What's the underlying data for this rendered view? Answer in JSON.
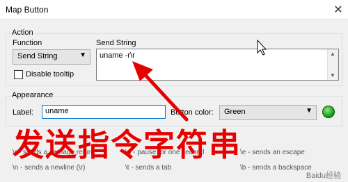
{
  "window": {
    "title": "Map Button"
  },
  "action": {
    "group_label": "Action",
    "function_label": "Function",
    "function_value": "Send String",
    "send_string_label": "Send String",
    "send_string_value": "uname -r\\r",
    "disable_tooltip_label": "Disable tooltip"
  },
  "appearance": {
    "group_label": "Appearance",
    "label_label": "Label:",
    "label_value": "uname",
    "button_color_label": "Button color:",
    "button_color_value": "Green"
  },
  "help_fragments": [
    "\\r - sends a carriage return",
    "\\p - pause for one second",
    "\\e - sends an escape",
    "\\n - sends a newline (\\r)",
    "\\t - sends a tab",
    "\\b - sends a backspace"
  ],
  "annotation": {
    "overlay_text": "发送指令字符串",
    "watermark": "Baidu经验"
  },
  "colors": {
    "accent_red": "#e60000",
    "button_green": "#1aa01a",
    "focus_blue": "#0078d7"
  },
  "icons": {
    "close": "close-icon",
    "dropdown": "chevron-down-icon",
    "color_swatch": "color-swatch-icon"
  }
}
